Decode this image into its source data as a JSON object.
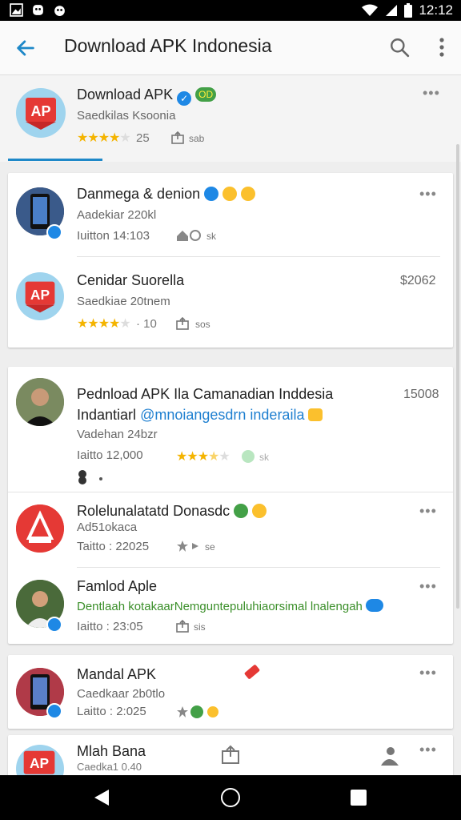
{
  "status_bar": {
    "time": "12:12"
  },
  "app_bar": {
    "title": "Download APK Indonesia"
  },
  "header_app": {
    "name": "Download APK",
    "badge": "OD",
    "sub": "Saedkilas Ksoonia",
    "rating_count": "25",
    "share_count": "sab"
  },
  "card1": {
    "items": [
      {
        "name": "Danmega & denion",
        "sub": "Aadekiar 220kl",
        "meta": "Iuitton 14:103",
        "stat": "sk"
      },
      {
        "name": "Cenidar Suorella",
        "sub": "Saedkiae 20tnem",
        "price": "$2062",
        "rating_count": "10",
        "stat": "sos"
      }
    ]
  },
  "card2": {
    "items": [
      {
        "name_line1": "Pednload APK Ila Camanadian Inddesia",
        "name_line2_a": "Indantiarl ",
        "name_line2_b": "@mnoiangesdrn inderaila",
        "sub": "Vadehan 24bzr",
        "meta": "Iaitto 12,000",
        "price": "15008",
        "stat": "sk"
      },
      {
        "name": "Rolelunalatatd Donasdc",
        "sub": "Ad51okaca",
        "meta": "Taitto : 22025",
        "stat": "se"
      },
      {
        "name": "Famlod Aple",
        "green": "Dentlaah kotakaarNemguntepuluhiaorsimal lnalengah",
        "meta": "Iaitto : 23:05",
        "stat": "sis"
      }
    ]
  },
  "card3": {
    "name": "Mandal APK",
    "sub": "Caedkaar 2b0tlo",
    "meta": "Laitto : 2:025"
  },
  "card4": {
    "name": "Mlah Bana",
    "sub": "Caedka1 0.40"
  },
  "colors": {
    "accent": "#1e88c8",
    "star": "#f4b400",
    "verified": "#1e88e5"
  }
}
